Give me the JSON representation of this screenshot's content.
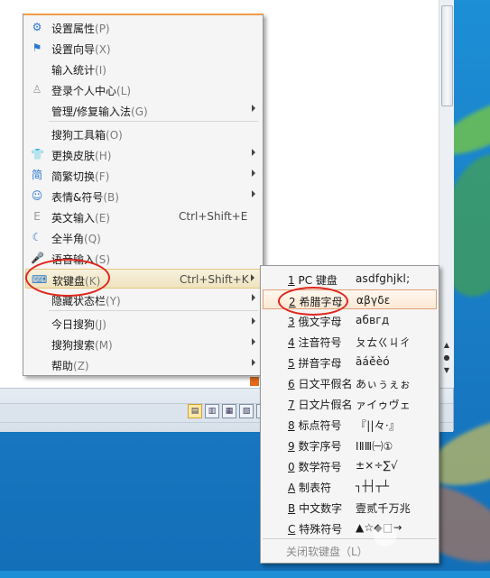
{
  "menu": {
    "items": [
      {
        "icon": "gear-icon",
        "glyph": "⚙",
        "label": "设置属性",
        "key": "(P)",
        "shortcut": "",
        "submenu": false
      },
      {
        "icon": "flag-icon",
        "glyph": "⚑",
        "label": "设置向导",
        "key": "(X)",
        "shortcut": "",
        "submenu": false
      },
      {
        "icon": "",
        "glyph": "",
        "label": "输入统计",
        "key": "(I)",
        "shortcut": "",
        "submenu": false
      },
      {
        "icon": "user-icon",
        "glyph": "♙",
        "label": "登录个人中心",
        "key": "(L)",
        "shortcut": "",
        "submenu": false
      },
      {
        "icon": "",
        "glyph": "",
        "label": "管理/修复输入法",
        "key": "(G)",
        "shortcut": "",
        "submenu": true
      },
      {
        "icon": "",
        "glyph": "",
        "label": "搜狗工具箱",
        "key": "(O)",
        "shortcut": "",
        "submenu": false
      },
      {
        "icon": "shirt-icon",
        "glyph": "👕",
        "label": "更换皮肤",
        "key": "(H)",
        "shortcut": "",
        "submenu": true
      },
      {
        "icon": "traditional-simplified-icon",
        "glyph": "简",
        "label": "简繁切换",
        "key": "(F)",
        "shortcut": "",
        "submenu": true
      },
      {
        "icon": "smiley-icon",
        "glyph": "☺",
        "label": "表情&符号",
        "key": "(B)",
        "shortcut": "",
        "submenu": true
      },
      {
        "icon": "english-icon",
        "glyph": "E",
        "label": "英文输入",
        "key": "(E)",
        "shortcut": "Ctrl+Shift+E",
        "submenu": false
      },
      {
        "icon": "half-moon-icon",
        "glyph": "☾",
        "label": "全半角",
        "key": "(Q)",
        "shortcut": "",
        "submenu": false
      },
      {
        "icon": "microphone-icon",
        "glyph": "🎤",
        "label": "语音输入",
        "key": "(S)",
        "shortcut": "",
        "submenu": false
      },
      {
        "icon": "keyboard-icon",
        "glyph": "⌨",
        "label": "软键盘",
        "key": "(K)",
        "shortcut": "Ctrl+Shift+K",
        "submenu": true
      },
      {
        "icon": "",
        "glyph": "",
        "label": "隐藏状态栏",
        "key": "(Y)",
        "shortcut": "",
        "submenu": true
      },
      {
        "icon": "",
        "glyph": "",
        "label": "今日搜狗",
        "key": "(J)",
        "shortcut": "",
        "submenu": true
      },
      {
        "icon": "",
        "glyph": "",
        "label": "搜狗搜索",
        "key": "(M)",
        "shortcut": "",
        "submenu": true
      },
      {
        "icon": "",
        "glyph": "",
        "label": "帮助",
        "key": "(Z)",
        "shortcut": "",
        "submenu": true
      }
    ]
  },
  "submenu": {
    "items": [
      {
        "num": "1",
        "label": "PC 键盘",
        "sample": "asdfghjkl;"
      },
      {
        "num": "2",
        "label": "希腊字母",
        "sample": "αβγδε"
      },
      {
        "num": "3",
        "label": "俄文字母",
        "sample": "абвгд"
      },
      {
        "num": "4",
        "label": "注音符号",
        "sample": "ㄆㄊㄍㄐㄔ"
      },
      {
        "num": "5",
        "label": "拼音字母",
        "sample": "āáěèó"
      },
      {
        "num": "6",
        "label": "日文平假名",
        "sample": "あぃぅぇぉ"
      },
      {
        "num": "7",
        "label": "日文片假名",
        "sample": "ァイゥヴェ"
      },
      {
        "num": "8",
        "label": "标点符号",
        "sample": "『||々·』"
      },
      {
        "num": "9",
        "label": "数字序号",
        "sample": "ⅠⅡⅢ㈠①"
      },
      {
        "num": "0",
        "label": "数学符号",
        "sample": "±×÷∑√"
      },
      {
        "num": "A",
        "label": "制表符",
        "sample": "┐┼┤┬┴"
      },
      {
        "num": "B",
        "label": "中文数字",
        "sample": "壹贰千万兆"
      },
      {
        "num": "C",
        "label": "特殊符号",
        "sample": "▲☆◆□→"
      }
    ],
    "close_label": "关闭软键盘（L）"
  },
  "statusbar": {
    "buttons": [
      "▤",
      "▥",
      "▦",
      "▧",
      "▨"
    ]
  },
  "colors": {
    "highlight": "#f0e4bf",
    "annotation": "#e0261c",
    "desktop": "#1a7fc8"
  }
}
